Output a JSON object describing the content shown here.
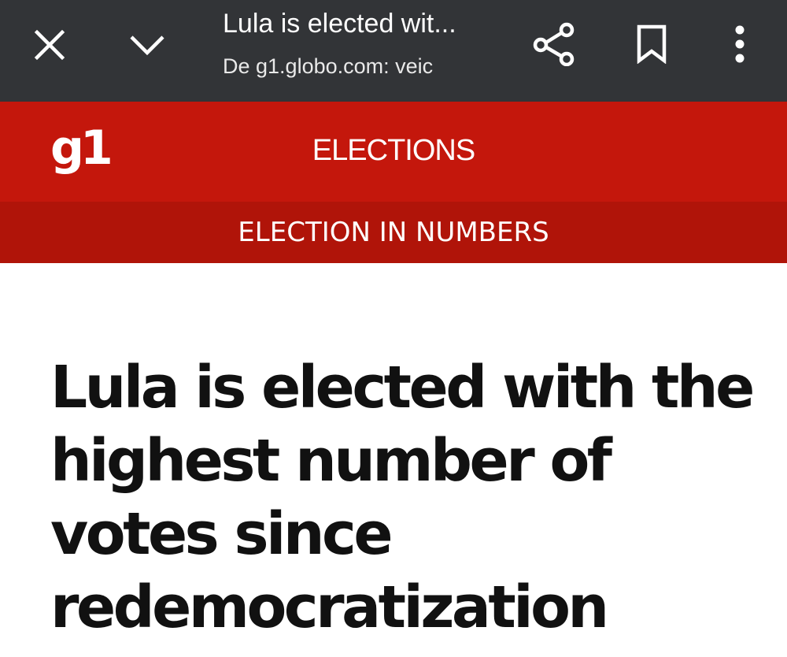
{
  "browser": {
    "title": "Lula is elected wit...",
    "url": "De g1.globo.com: veic",
    "icons": {
      "close": "close-icon",
      "collapse": "chevron-down-icon",
      "share": "share-icon",
      "bookmark": "bookmark-icon",
      "menu": "more-vert-icon"
    }
  },
  "site": {
    "logo": "g1",
    "section": "ELECTIONS",
    "subsection": "ELECTION IN NUMBERS",
    "colors": {
      "header": "#c4170c",
      "subheader": "#b01409",
      "browser_bar": "#323437"
    }
  },
  "article": {
    "headline": "Lula is elected with the highest number of votes since redemocratization"
  }
}
